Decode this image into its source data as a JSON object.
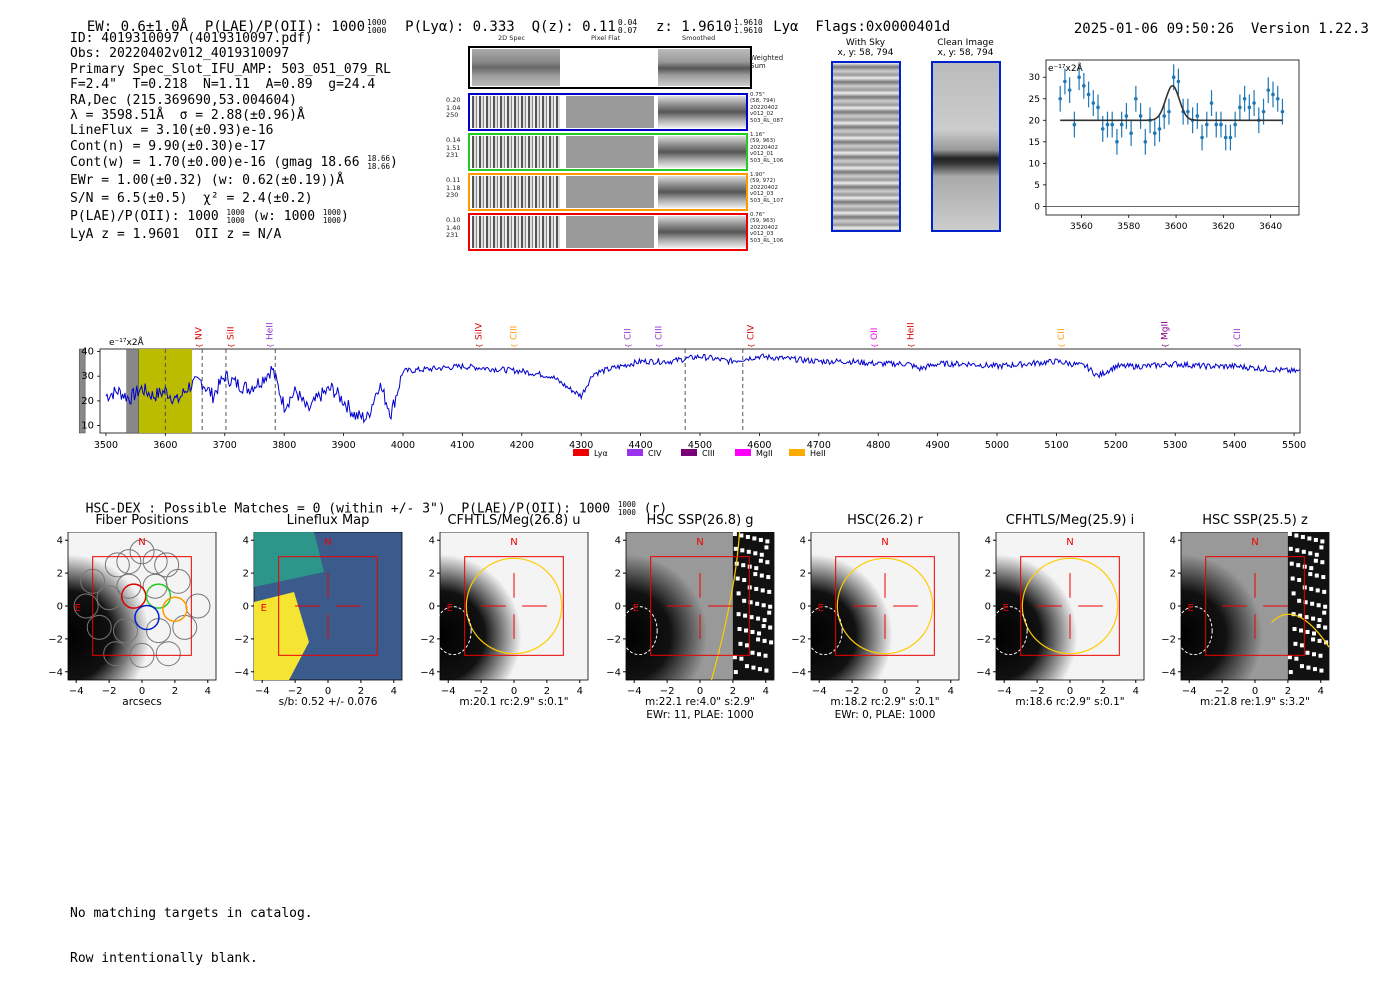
{
  "header": {
    "ew_text": "EW: 0.6±1.0Å  P(LAE)/P(OII): 1000",
    "ew_frac_top": "1000",
    "ew_frac_bot": "1000",
    "plya_text": "P(Lyα): 0.333  Q(z): 0.11",
    "q_frac_top": "0.04",
    "q_frac_bot": "0.07",
    "z_text": "z: 1.9610",
    "z_frac_top": "1.9610",
    "z_frac_bot": "1.9610",
    "line_text": "Lyα  Flags:0x0000401d",
    "timestamp": "2025-01-06 09:50:26",
    "version": "Version 1.22.3"
  },
  "info": {
    "id": "ID: 4019310097 (4019310097.pdf)",
    "obs": "Obs: 20220402v012_4019310097",
    "primary": "Primary Spec_Slot_IFU_AMP: 503_051_079_RL",
    "params": "F=2.4\"  T=0.218  N=1.11  A=0.89  g=24.4",
    "radec": "RA,Dec (215.369690,53.004604)",
    "lambda": "λ = 3598.51Å  σ = 2.88(±0.96)Å",
    "lineflux": "LineFlux = 3.10(±0.93)e-16",
    "contn": "Cont(n) = 9.90(±0.30)e-17",
    "contw": "Cont(w) = 1.70(±0.00)e-16 (gmag 18.66",
    "contw_top": "18.66",
    "contw_bot": "18.66",
    "contw_end": ")",
    "ewr": "EWr = 1.00(±0.32) (w: 0.62(±0.19))Å",
    "sn": "S/N = 6.5(±0.5)  χ² = 2.4(±0.2)",
    "plae": "P(LAE)/P(OII): 1000",
    "plae_top": "1000",
    "plae_bot": "1000",
    "plae_mid": "(w: 1000",
    "plae_w_top": "1000",
    "plae_w_bot": "1000",
    "plae_end": ")",
    "lyaz": "LyA z = 1.9601  OII z = N/A"
  },
  "cutouts": {
    "col_headers": [
      "2D Spec",
      "Pixel Flat",
      "Smoothed"
    ],
    "weighted_label": "Weighted\nSum",
    "rows": [
      {
        "left": "0.20\n1.04\n250",
        "right": "0.75\"\n(58, 794)\n20220402\nv012_02\n503_RL_087",
        "color": "#0000cc"
      },
      {
        "left": "0.14\n1.51\n231",
        "right": "1.16\"\n(59, 963)\n20220402\nv012_01\n503_RL_106",
        "color": "#22cc22"
      },
      {
        "left": "0.11\n1.18\n230",
        "right": "1.90\"\n(59, 972)\n20220402\nv012_03\n503_RL_107",
        "color": "#ff9900"
      },
      {
        "left": "0.10\n1.40\n231",
        "right": "0.76\"\n(59, 963)\n20220402\nv012_03\n503_RL_106",
        "color": "#ee0000"
      }
    ],
    "with_sky_title": "With Sky",
    "with_sky_sub": "x, y: 58, 794",
    "clean_title": "Clean Image",
    "clean_sub": "x, y: 58, 794"
  },
  "emission_labels": [
    {
      "name": "NV",
      "wave": 3656,
      "color": "#dd0000"
    },
    {
      "name": "SiII",
      "wave": 3710,
      "color": "#dd0000"
    },
    {
      "name": "HeII",
      "wave": 3775,
      "color": "#9933cc"
    },
    {
      "name": "SiIV",
      "wave": 4127,
      "color": "#dd0000"
    },
    {
      "name": "CIII",
      "wave": 4186,
      "color": "#ff9900"
    },
    {
      "name": "CII",
      "wave": 4378,
      "color": "#9933cc"
    },
    {
      "name": "CIII",
      "wave": 4430,
      "color": "#9933cc"
    },
    {
      "name": "CIV",
      "wave": 4585,
      "color": "#dd0000"
    },
    {
      "name": "OII",
      "wave": 4793,
      "color": "#ee00ee"
    },
    {
      "name": "HeII",
      "wave": 4854,
      "color": "#dd0000"
    },
    {
      "name": "CII",
      "wave": 5108,
      "color": "#ff9900"
    },
    {
      "name": "MgII",
      "wave": 5282,
      "color": "#880088"
    },
    {
      "name": "CII",
      "wave": 5404,
      "color": "#9933cc"
    }
  ],
  "legend": [
    {
      "label": "Lyα",
      "color": "#ee0000"
    },
    {
      "label": "CIV",
      "color": "#9933ee"
    },
    {
      "label": "CIII",
      "color": "#770077"
    },
    {
      "label": "MgII",
      "color": "#ff00ff"
    },
    {
      "label": "HeII",
      "color": "#ffaa00"
    }
  ],
  "hsc_line": {
    "text": "HSC-DEX : Possible Matches = 0 (within +/- 3\")  P(LAE)/P(OII): 1000",
    "top": "1000",
    "bot": "1000",
    "end": "(r)"
  },
  "image_panels": [
    {
      "title": "Fiber Positions",
      "caption": "arcsecs",
      "caption2": ""
    },
    {
      "title": "Lineflux Map",
      "caption": "s/b: 0.52 +/- 0.076",
      "caption2": ""
    },
    {
      "title": "CFHTLS/Meg(26.8) u",
      "caption": "m:20.1 rc:2.9\"  s:0.1\"",
      "caption2": ""
    },
    {
      "title": "HSC SSP(26.8) g",
      "caption": "m:22.1  re:4.0\"  s:2.9\"",
      "caption2": "EWr: 11, PLAE: 1000"
    },
    {
      "title": "HSC(26.2) r",
      "caption": "m:18.2 rc:2.9\"  s:0.1\"",
      "caption2": "EWr: 0, PLAE: 1000"
    },
    {
      "title": "CFHTLS/Meg(25.9) i",
      "caption": "m:18.6 rc:2.9\"  s:0.1\"",
      "caption2": ""
    },
    {
      "title": "HSC SSP(25.5) z",
      "caption": "m:21.8  re:1.9\"  s:3.2\"",
      "caption2": ""
    }
  ],
  "panel_labels": {
    "north": "N",
    "east": "E"
  },
  "footer": {
    "line1": "No matching targets in catalog.",
    "line2": "Row intentionally blank."
  },
  "chart_data": [
    {
      "type": "scatter",
      "name": "line-fit",
      "title": "",
      "ylabel": "e⁻¹⁷x2Å",
      "xlim": [
        3545,
        3652
      ],
      "ylim": [
        -2,
        34
      ],
      "xticks": [
        3560,
        3580,
        3600,
        3620,
        3640
      ],
      "yticks": [
        0,
        5,
        10,
        15,
        20,
        25,
        30
      ],
      "points": {
        "x": [
          3551,
          3553,
          3555,
          3557,
          3559,
          3561,
          3563,
          3565,
          3567,
          3569,
          3571,
          3573,
          3575,
          3577,
          3579,
          3581,
          3583,
          3585,
          3587,
          3589,
          3591,
          3593,
          3595,
          3597,
          3599,
          3601,
          3603,
          3605,
          3607,
          3609,
          3611,
          3613,
          3615,
          3617,
          3619,
          3621,
          3623,
          3625,
          3627,
          3629,
          3631,
          3633,
          3635,
          3637,
          3639,
          3641,
          3643,
          3645
        ],
        "y": [
          25,
          29,
          27,
          19,
          30,
          28,
          26,
          24,
          23,
          18,
          19,
          19,
          15,
          19,
          21,
          17,
          25,
          21,
          15,
          20,
          17,
          18,
          21,
          22,
          30,
          29,
          22,
          22,
          20,
          21,
          16,
          19,
          24,
          19,
          19,
          16,
          16,
          19,
          23,
          25,
          23,
          24,
          20,
          22,
          27,
          26,
          25,
          22
        ]
      },
      "fit": {
        "center": 3598.5,
        "sigma": 2.88,
        "continuum": 20,
        "amplitude": 8
      }
    },
    {
      "type": "line",
      "name": "full-spectrum",
      "ylabel": "e⁻¹⁷x2Å",
      "xlim": [
        3490,
        5510
      ],
      "ylim": [
        7,
        41
      ],
      "xticks": [
        3500,
        3600,
        3700,
        3800,
        3900,
        4000,
        4100,
        4200,
        4300,
        4400,
        4500,
        4600,
        4700,
        4800,
        4900,
        5000,
        5100,
        5200,
        5300,
        5400,
        5500
      ],
      "yticks": [
        10,
        20,
        30,
        40
      ],
      "knots_x": [
        3500,
        3520,
        3540,
        3560,
        3580,
        3600,
        3620,
        3640,
        3660,
        3680,
        3700,
        3720,
        3740,
        3760,
        3780,
        3800,
        3820,
        3840,
        3860,
        3880,
        3900,
        3920,
        3940,
        3960,
        3980,
        4000,
        4050,
        4100,
        4150,
        4200,
        4250,
        4280,
        4300,
        4320,
        4350,
        4400,
        4450,
        4500,
        4550,
        4600,
        4650,
        4700,
        4750,
        4800,
        4850,
        4870,
        4900,
        4950,
        5000,
        5050,
        5100,
        5150,
        5170,
        5200,
        5250,
        5300,
        5350,
        5400,
        5450,
        5500
      ],
      "knots_y": [
        22,
        24,
        21,
        25,
        22,
        24,
        20,
        26,
        28,
        22,
        30,
        27,
        25,
        28,
        33,
        18,
        24,
        16,
        22,
        25,
        20,
        14,
        13,
        27,
        15,
        32,
        33,
        34,
        33,
        32,
        30,
        25,
        22,
        31,
        33,
        36,
        36,
        38,
        36,
        38,
        37,
        36,
        36,
        35,
        35,
        33,
        35,
        35,
        34,
        35,
        36,
        34,
        30,
        34,
        34,
        35,
        34,
        34,
        33,
        32
      ],
      "shaded_fit_region": [
        3555,
        3645
      ],
      "masked_regions": [
        [
          3535,
          3555
        ],
        [
          3455,
          3465
        ]
      ],
      "dashed_lines": [
        3600,
        3662,
        3702,
        3785,
        4475,
        4572
      ]
    }
  ]
}
